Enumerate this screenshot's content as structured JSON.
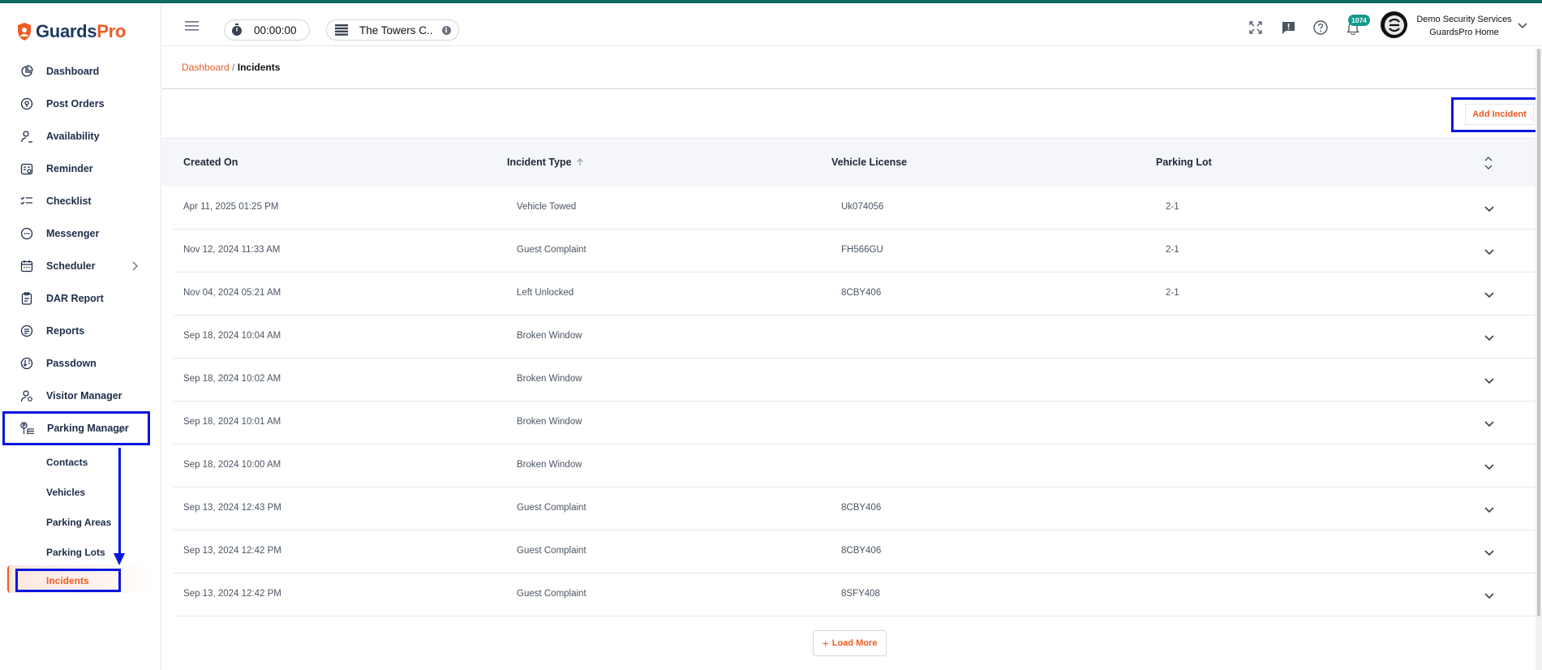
{
  "app": {
    "brand_first": "Guards",
    "brand_second": "Pro"
  },
  "sidebar": {
    "items": [
      {
        "label": "Dashboard",
        "icon": "pie-chart-icon"
      },
      {
        "label": "Post Orders",
        "icon": "location-pin-icon"
      },
      {
        "label": "Availability",
        "icon": "person-clock-icon"
      },
      {
        "label": "Reminder",
        "icon": "calendar-reminder-icon"
      },
      {
        "label": "Checklist",
        "icon": "checklist-icon"
      },
      {
        "label": "Messenger",
        "icon": "chat-bubble-icon"
      },
      {
        "label": "Scheduler",
        "icon": "calendar-icon"
      },
      {
        "label": "DAR Report",
        "icon": "clipboard-icon"
      },
      {
        "label": "Reports",
        "icon": "report-list-icon"
      },
      {
        "label": "Passdown",
        "icon": "passdown-icon"
      },
      {
        "label": "Visitor Manager",
        "icon": "visitor-icon"
      },
      {
        "label": "Parking Manager",
        "icon": "parking-icon"
      }
    ],
    "sub_items": [
      {
        "label": "Contacts"
      },
      {
        "label": "Vehicles"
      },
      {
        "label": "Parking Areas"
      },
      {
        "label": "Parking Lots"
      },
      {
        "label": "Incidents"
      }
    ]
  },
  "header": {
    "timer": "00:00:00",
    "site_name": "The Towers C..",
    "site_info": "i",
    "notification_count": "1074",
    "org_name": "Demo Security Services",
    "org_sub": "GuardsPro Home"
  },
  "breadcrumb": {
    "home": "Dashboard",
    "separator": " / ",
    "current": "Incidents"
  },
  "toolbar": {
    "add_label": "Add Incident"
  },
  "table": {
    "columns": [
      "Created On",
      "Incident Type",
      "Vehicle License",
      "Parking Lot"
    ],
    "rows": [
      {
        "created": "Apr 11, 2025 01:25 PM",
        "type": "Vehicle Towed",
        "license": "Uk074056",
        "lot": "2-1"
      },
      {
        "created": "Nov 12, 2024 11:33 AM",
        "type": "Guest Complaint",
        "license": "FH566GU",
        "lot": "2-1"
      },
      {
        "created": "Nov 04, 2024 05:21 AM",
        "type": "Left Unlocked",
        "license": "8CBY406",
        "lot": "2-1"
      },
      {
        "created": "Sep 18, 2024 10:04 AM",
        "type": "Broken Window",
        "license": "",
        "lot": ""
      },
      {
        "created": "Sep 18, 2024 10:02 AM",
        "type": "Broken Window",
        "license": "",
        "lot": ""
      },
      {
        "created": "Sep 18, 2024 10:01 AM",
        "type": "Broken Window",
        "license": "",
        "lot": ""
      },
      {
        "created": "Sep 18, 2024 10:00 AM",
        "type": "Broken Window",
        "license": "",
        "lot": ""
      },
      {
        "created": "Sep 13, 2024 12:43 PM",
        "type": "Guest Complaint",
        "license": "8CBY406",
        "lot": ""
      },
      {
        "created": "Sep 13, 2024 12:42 PM",
        "type": "Guest Complaint",
        "license": "8CBY406",
        "lot": ""
      },
      {
        "created": "Sep 13, 2024 12:42 PM",
        "type": "Guest Complaint",
        "license": "8SFY408",
        "lot": ""
      }
    ]
  },
  "footer": {
    "load_more": "Load More"
  },
  "colors": {
    "accent": "#f15a24",
    "navy": "#1e3a5f",
    "highlight_box": "#0a14e0",
    "badge": "#139a8a"
  }
}
